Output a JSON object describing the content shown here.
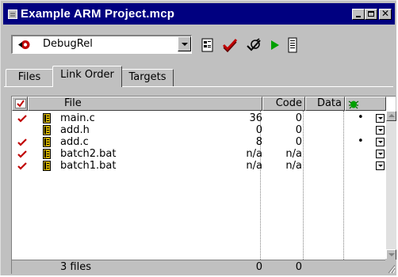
{
  "window": {
    "title": "Example ARM Project.mcp"
  },
  "toolbar": {
    "target_value": "DebugRel",
    "tools": [
      "target-settings-icon",
      "synchronize-modification-dates-icon",
      "make-icon",
      "debug-icon",
      "project-inspector-icon"
    ]
  },
  "tabs": [
    {
      "label": "Files",
      "active": false
    },
    {
      "label": "Link Order",
      "active": true
    },
    {
      "label": "Targets",
      "active": false
    }
  ],
  "columns": {
    "file": "File",
    "code": "Code",
    "data": "Data"
  },
  "rows": [
    {
      "checked": true,
      "name": "main.c",
      "code": "36",
      "data": "0",
      "debug": true
    },
    {
      "checked": false,
      "name": "add.h",
      "code": "0",
      "data": "0",
      "debug": false
    },
    {
      "checked": true,
      "name": "add.c",
      "code": "8",
      "data": "0",
      "debug": true
    },
    {
      "checked": true,
      "name": "batch2.bat",
      "code": "n/a",
      "data": "n/a",
      "debug": false
    },
    {
      "checked": true,
      "name": "batch1.bat",
      "code": "n/a",
      "data": "n/a",
      "debug": false
    }
  ],
  "status": {
    "count": "3 files",
    "code_total": "0",
    "data_total": "0"
  },
  "colors": {
    "title_bar": "#000080",
    "face": "#c0c0c0",
    "check": "#c00000",
    "run": "#00a000"
  }
}
